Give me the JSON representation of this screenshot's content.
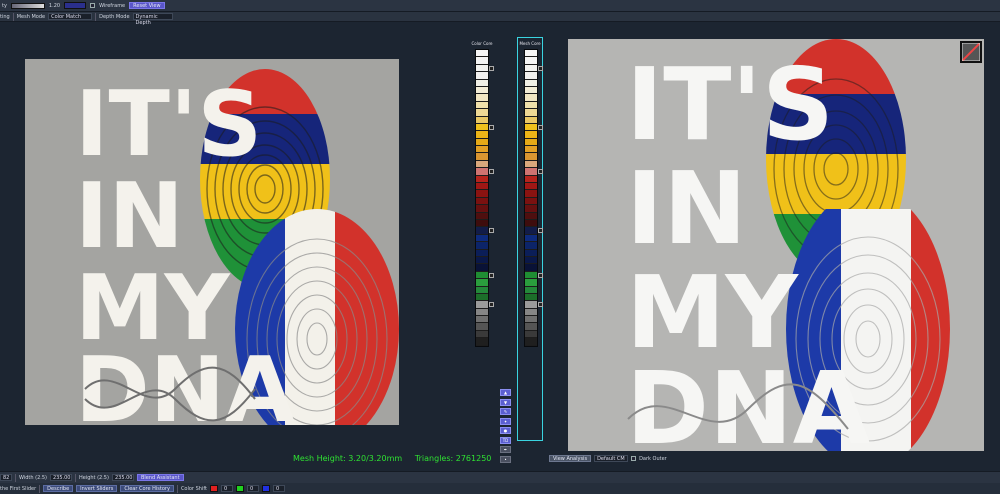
{
  "toolbar": {
    "brightness_value": "1.20",
    "wireframe_label": "Wireframe",
    "reset_view_label": "Reset View"
  },
  "toolbar2": {
    "left_label": "ting",
    "mesh_mode_label": "Mesh Mode",
    "mesh_mode_value": "Color Match",
    "depth_mode_label": "Depth Mode",
    "depth_mode_value": "Dynamic Depth"
  },
  "palettes": {
    "color_core_title": "Color Core",
    "mesh_core_title": "Mesh Core",
    "cells": [
      "#f6f6f6",
      "#f4f4f4",
      "#f2f2f0",
      "#f1f0ee",
      "#f0efe6",
      "#f2ecd6",
      "#f1e6c2",
      "#efe0aa",
      "#eed894",
      "#e9c865",
      "#efc11d",
      "#edb517",
      "#e5a917",
      "#e19f25",
      "#d99531",
      "#d9a87c",
      "#cf7371",
      "#b5231c",
      "#9f1715",
      "#8a1311",
      "#7a1110",
      "#661010",
      "#4e0f0f",
      "#3e0d0d",
      "#121c48",
      "#0e2b7e",
      "#0c2468",
      "#0b1e58",
      "#0a1848",
      "#091236",
      "#1f8d33",
      "#2a9e3d",
      "#24883a",
      "#1c6e2a",
      "#9b9b9b",
      "#868686",
      "#6f6f6f",
      "#555555",
      "#3a3a3a",
      "#1f1f1f"
    ]
  },
  "status": {
    "mesh_height": "Mesh Height: 3.20/3.20mm",
    "triangles": "Triangles: 2761250"
  },
  "view_bar": {
    "view_analysis": "View Analysis",
    "default_cm": "Default CM",
    "dark_outer": "Dark Outer"
  },
  "bottom": {
    "field_left": "82",
    "width_label": "Width (2.5)",
    "width_value": "235.00",
    "height_label": "Height (2.5)",
    "height_value": "235.00",
    "blend_label": "Blend Assistant",
    "first_slider": "the First Slider",
    "describe": "Describe",
    "invert_sliders": "Invert Sliders",
    "clear_history": "Clear Core History",
    "color_shift": "Color Shift",
    "r_value": "0",
    "g_value": "0",
    "b_value": "0"
  },
  "artwork": {
    "line1": "IT'S",
    "line2": "IN",
    "line3": "MY",
    "line4": "DNA"
  },
  "colors": {
    "flag_red": "#d2322b",
    "flag_blue": "#16257a",
    "flag_yellow": "#f0c119",
    "flag_green": "#1f9138",
    "fr_blue": "#1d3aa8",
    "fr_red": "#d2322b",
    "accent_cyan": "#3ad4e0",
    "status_green": "#2fe232"
  }
}
